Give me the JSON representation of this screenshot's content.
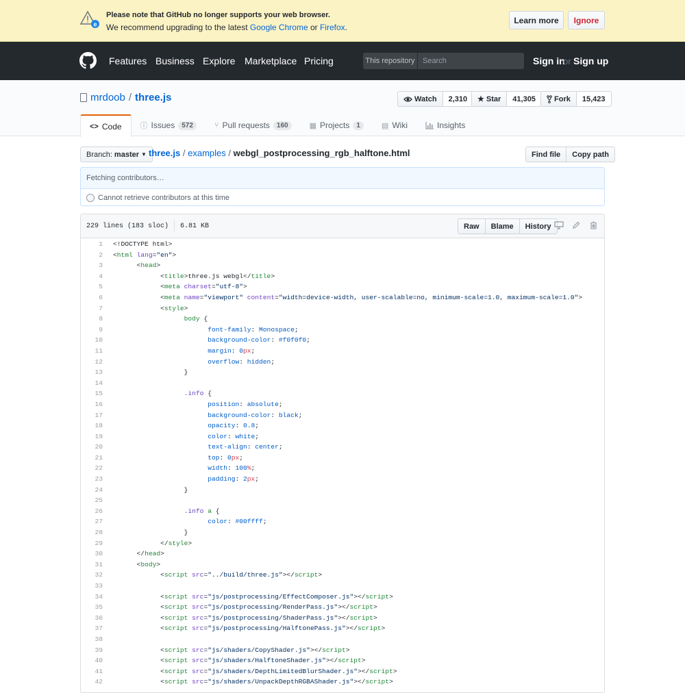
{
  "banner": {
    "line1": "Please note that GitHub no longer supports your web browser.",
    "line2_prefix": "We recommend upgrading to the latest ",
    "chrome": "Google Chrome",
    "or": " or ",
    "firefox": "Firefox",
    "period": ".",
    "learn_more": "Learn more",
    "ignore": "Ignore"
  },
  "header": {
    "nav": [
      "Features",
      "Business",
      "Explore",
      "Marketplace",
      "Pricing"
    ],
    "search_scope": "This repository",
    "search_placeholder": "Search",
    "sign_in": "Sign in",
    "or": "or",
    "sign_up": "Sign up"
  },
  "repo": {
    "owner": "mrdoob",
    "separator": "/",
    "name": "three.js",
    "watch_label": "Watch",
    "watch_count": "2,310",
    "star_label": "Star",
    "star_count": "41,305",
    "fork_label": "Fork",
    "fork_count": "15,423",
    "tabs": [
      {
        "label": "Code",
        "icon": "code-icon",
        "counter": ""
      },
      {
        "label": "Issues",
        "icon": "issue-icon",
        "counter": "572"
      },
      {
        "label": "Pull requests",
        "icon": "pull-request-icon",
        "counter": "160"
      },
      {
        "label": "Projects",
        "icon": "project-icon",
        "counter": "1"
      },
      {
        "label": "Wiki",
        "icon": "book-icon",
        "counter": ""
      },
      {
        "label": "Insights",
        "icon": "graph-icon",
        "counter": ""
      }
    ]
  },
  "file_nav": {
    "branch_label": "Branch:",
    "branch": "master",
    "path": [
      "three.js",
      "examples"
    ],
    "sep": "/",
    "filename": "webgl_postprocessing_rgb_halftone.html",
    "find_file": "Find file",
    "copy_path": "Copy path"
  },
  "contributors": {
    "fetching": "Fetching contributors…",
    "error": "Cannot retrieve contributors at this time"
  },
  "file": {
    "lines_info": "229 lines (183 sloc)",
    "size": "6.81 KB",
    "raw": "Raw",
    "blame": "Blame",
    "history": "History"
  },
  "code_lines": [
    [
      [
        "",
        "<!DOCTYPE html>"
      ]
    ],
    [
      [
        "",
        "<"
      ],
      [
        "tg",
        "html"
      ],
      [
        "",
        " "
      ],
      [
        "at",
        "lang"
      ],
      [
        "",
        "="
      ],
      [
        "st",
        "\"en\""
      ],
      [
        "",
        ">"
      ]
    ],
    [
      [
        "",
        "\t<"
      ],
      [
        "tg",
        "head"
      ],
      [
        "",
        ">"
      ]
    ],
    [
      [
        "",
        "\t\t<"
      ],
      [
        "tg",
        "title"
      ],
      [
        "",
        ">three.js webgl</"
      ],
      [
        "tg",
        "title"
      ],
      [
        "",
        ">"
      ]
    ],
    [
      [
        "",
        "\t\t<"
      ],
      [
        "tg",
        "meta"
      ],
      [
        "",
        " "
      ],
      [
        "at",
        "charset"
      ],
      [
        "",
        "="
      ],
      [
        "st",
        "\"utf-8\""
      ],
      [
        "",
        ">"
      ]
    ],
    [
      [
        "",
        "\t\t<"
      ],
      [
        "tg",
        "meta"
      ],
      [
        "",
        " "
      ],
      [
        "at",
        "name"
      ],
      [
        "",
        "="
      ],
      [
        "st",
        "\"viewport\""
      ],
      [
        "",
        " "
      ],
      [
        "at",
        "content"
      ],
      [
        "",
        "="
      ],
      [
        "st",
        "\"width=device-width, user-scalable=no, minimum-scale=1.0, maximum-scale=1.0\""
      ],
      [
        "",
        ">"
      ]
    ],
    [
      [
        "",
        "\t\t<"
      ],
      [
        "tg",
        "style"
      ],
      [
        "",
        ">"
      ]
    ],
    [
      [
        "",
        "\t\t\t"
      ],
      [
        "tg",
        "body"
      ],
      [
        "",
        " {"
      ]
    ],
    [
      [
        "",
        "\t\t\t\t"
      ],
      [
        "pr",
        "font-family"
      ],
      [
        "",
        ": "
      ],
      [
        "pr",
        "Monospace"
      ],
      [
        "",
        ";"
      ]
    ],
    [
      [
        "",
        "\t\t\t\t"
      ],
      [
        "pr",
        "background-color"
      ],
      [
        "",
        ": "
      ],
      [
        "pr",
        "#f0f0f0"
      ],
      [
        "",
        ";"
      ]
    ],
    [
      [
        "",
        "\t\t\t\t"
      ],
      [
        "pr",
        "margin"
      ],
      [
        "",
        ": "
      ],
      [
        "pr",
        "0"
      ],
      [
        "kw",
        "px"
      ],
      [
        "",
        ";"
      ]
    ],
    [
      [
        "",
        "\t\t\t\t"
      ],
      [
        "pr",
        "overflow"
      ],
      [
        "",
        ": "
      ],
      [
        "pr",
        "hidden"
      ],
      [
        "",
        ";"
      ]
    ],
    [
      [
        "",
        "\t\t\t}"
      ]
    ],
    [
      [
        "",
        ""
      ]
    ],
    [
      [
        "",
        "\t\t\t"
      ],
      [
        "at",
        ".info"
      ],
      [
        "",
        " {"
      ]
    ],
    [
      [
        "",
        "\t\t\t\t"
      ],
      [
        "pr",
        "position"
      ],
      [
        "",
        ": "
      ],
      [
        "pr",
        "absolute"
      ],
      [
        "",
        ";"
      ]
    ],
    [
      [
        "",
        "\t\t\t\t"
      ],
      [
        "pr",
        "background-color"
      ],
      [
        "",
        ": "
      ],
      [
        "pr",
        "black"
      ],
      [
        "",
        ";"
      ]
    ],
    [
      [
        "",
        "\t\t\t\t"
      ],
      [
        "pr",
        "opacity"
      ],
      [
        "",
        ": "
      ],
      [
        "pr",
        "0.8"
      ],
      [
        "",
        ";"
      ]
    ],
    [
      [
        "",
        "\t\t\t\t"
      ],
      [
        "pr",
        "color"
      ],
      [
        "",
        ": "
      ],
      [
        "pr",
        "white"
      ],
      [
        "",
        ";"
      ]
    ],
    [
      [
        "",
        "\t\t\t\t"
      ],
      [
        "pr",
        "text-align"
      ],
      [
        "",
        ": "
      ],
      [
        "pr",
        "center"
      ],
      [
        "",
        ";"
      ]
    ],
    [
      [
        "",
        "\t\t\t\t"
      ],
      [
        "pr",
        "top"
      ],
      [
        "",
        ": "
      ],
      [
        "pr",
        "0"
      ],
      [
        "kw",
        "px"
      ],
      [
        "",
        ";"
      ]
    ],
    [
      [
        "",
        "\t\t\t\t"
      ],
      [
        "pr",
        "width"
      ],
      [
        "",
        ": "
      ],
      [
        "pr",
        "100"
      ],
      [
        "kw",
        "%"
      ],
      [
        "",
        ";"
      ]
    ],
    [
      [
        "",
        "\t\t\t\t"
      ],
      [
        "pr",
        "padding"
      ],
      [
        "",
        ": "
      ],
      [
        "pr",
        "2"
      ],
      [
        "kw",
        "px"
      ],
      [
        "",
        ";"
      ]
    ],
    [
      [
        "",
        "\t\t\t}"
      ]
    ],
    [
      [
        "",
        ""
      ]
    ],
    [
      [
        "",
        "\t\t\t"
      ],
      [
        "at",
        ".info"
      ],
      [
        "",
        " "
      ],
      [
        "tg",
        "a"
      ],
      [
        "",
        " {"
      ]
    ],
    [
      [
        "",
        "\t\t\t\t"
      ],
      [
        "pr",
        "color"
      ],
      [
        "",
        ": "
      ],
      [
        "pr",
        "#00ffff"
      ],
      [
        "",
        ";"
      ]
    ],
    [
      [
        "",
        "\t\t\t}"
      ]
    ],
    [
      [
        "",
        "\t\t</"
      ],
      [
        "tg",
        "style"
      ],
      [
        "",
        ">"
      ]
    ],
    [
      [
        "",
        "\t</"
      ],
      [
        "tg",
        "head"
      ],
      [
        "",
        ">"
      ]
    ],
    [
      [
        "",
        "\t<"
      ],
      [
        "tg",
        "body"
      ],
      [
        "",
        ">"
      ]
    ],
    [
      [
        "",
        "\t\t<"
      ],
      [
        "tg",
        "script"
      ],
      [
        "",
        " "
      ],
      [
        "at",
        "src"
      ],
      [
        "",
        "="
      ],
      [
        "st",
        "\"../build/three.js\""
      ],
      [
        "",
        "></"
      ],
      [
        "tg",
        "script"
      ],
      [
        "",
        ">"
      ]
    ],
    [
      [
        "",
        ""
      ]
    ],
    [
      [
        "",
        "\t\t<"
      ],
      [
        "tg",
        "script"
      ],
      [
        "",
        " "
      ],
      [
        "at",
        "src"
      ],
      [
        "",
        "="
      ],
      [
        "st",
        "\"js/postprocessing/EffectComposer.js\""
      ],
      [
        "",
        "></"
      ],
      [
        "tg",
        "script"
      ],
      [
        "",
        ">"
      ]
    ],
    [
      [
        "",
        "\t\t<"
      ],
      [
        "tg",
        "script"
      ],
      [
        "",
        " "
      ],
      [
        "at",
        "src"
      ],
      [
        "",
        "="
      ],
      [
        "st",
        "\"js/postprocessing/RenderPass.js\""
      ],
      [
        "",
        "></"
      ],
      [
        "tg",
        "script"
      ],
      [
        "",
        ">"
      ]
    ],
    [
      [
        "",
        "\t\t<"
      ],
      [
        "tg",
        "script"
      ],
      [
        "",
        " "
      ],
      [
        "at",
        "src"
      ],
      [
        "",
        "="
      ],
      [
        "st",
        "\"js/postprocessing/ShaderPass.js\""
      ],
      [
        "",
        "></"
      ],
      [
        "tg",
        "script"
      ],
      [
        "",
        ">"
      ]
    ],
    [
      [
        "",
        "\t\t<"
      ],
      [
        "tg",
        "script"
      ],
      [
        "",
        " "
      ],
      [
        "at",
        "src"
      ],
      [
        "",
        "="
      ],
      [
        "st",
        "\"js/postprocessing/HalftonePass.js\""
      ],
      [
        "",
        "></"
      ],
      [
        "tg",
        "script"
      ],
      [
        "",
        ">"
      ]
    ],
    [
      [
        "",
        ""
      ]
    ],
    [
      [
        "",
        "\t\t<"
      ],
      [
        "tg",
        "script"
      ],
      [
        "",
        " "
      ],
      [
        "at",
        "src"
      ],
      [
        "",
        "="
      ],
      [
        "st",
        "\"js/shaders/CopyShader.js\""
      ],
      [
        "",
        "></"
      ],
      [
        "tg",
        "script"
      ],
      [
        "",
        ">"
      ]
    ],
    [
      [
        "",
        "\t\t<"
      ],
      [
        "tg",
        "script"
      ],
      [
        "",
        " "
      ],
      [
        "at",
        "src"
      ],
      [
        "",
        "="
      ],
      [
        "st",
        "\"js/shaders/HalftoneShader.js\""
      ],
      [
        "",
        "></"
      ],
      [
        "tg",
        "script"
      ],
      [
        "",
        ">"
      ]
    ],
    [
      [
        "",
        "\t\t<"
      ],
      [
        "tg",
        "script"
      ],
      [
        "",
        " "
      ],
      [
        "at",
        "src"
      ],
      [
        "",
        "="
      ],
      [
        "st",
        "\"js/shaders/DepthLimitedBlurShader.js\""
      ],
      [
        "",
        "></"
      ],
      [
        "tg",
        "script"
      ],
      [
        "",
        ">"
      ]
    ],
    [
      [
        "",
        "\t\t<"
      ],
      [
        "tg",
        "script"
      ],
      [
        "",
        " "
      ],
      [
        "at",
        "src"
      ],
      [
        "",
        "="
      ],
      [
        "st",
        "\"js/shaders/UnpackDepthRGBAShader.js\""
      ],
      [
        "",
        "></"
      ],
      [
        "tg",
        "script"
      ],
      [
        "",
        ">"
      ]
    ]
  ]
}
